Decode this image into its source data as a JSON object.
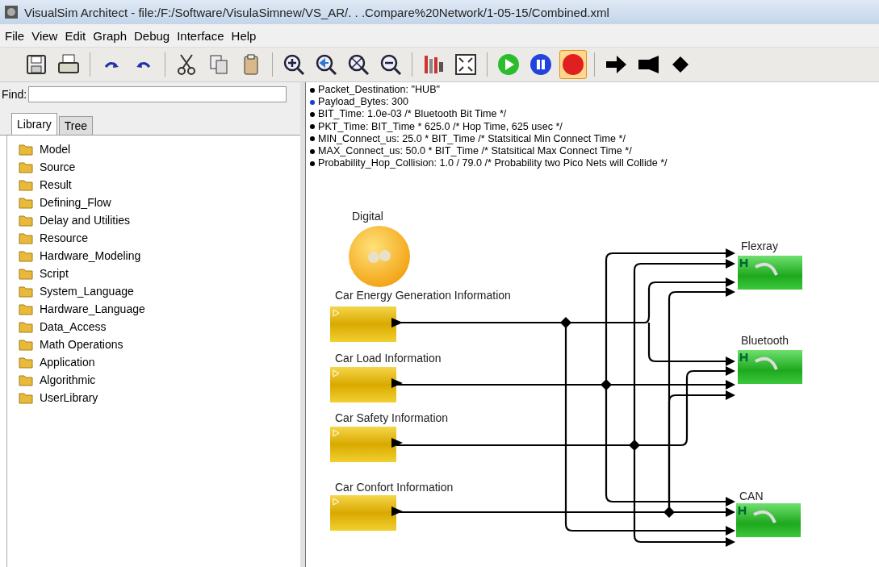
{
  "window": {
    "title": "VisualSim Architect - file:/F:/Software/VisulaSimnew/VS_AR/. . .Compare%20Network/1-05-15/Combined.xml"
  },
  "menu": [
    "File",
    "View",
    "Edit",
    "Graph",
    "Debug",
    "Interface",
    "Help"
  ],
  "toolbar": [
    {
      "kind": "save",
      "selected": false
    },
    {
      "kind": "print",
      "selected": false
    },
    {
      "kind": "sep"
    },
    {
      "kind": "redo",
      "selected": false
    },
    {
      "kind": "undo",
      "selected": false
    },
    {
      "kind": "sep"
    },
    {
      "kind": "cut",
      "selected": false
    },
    {
      "kind": "copy",
      "selected": false
    },
    {
      "kind": "paste",
      "selected": false
    },
    {
      "kind": "sep"
    },
    {
      "kind": "zoom-in",
      "selected": false
    },
    {
      "kind": "zoom-reset",
      "selected": false
    },
    {
      "kind": "zoom-fit",
      "selected": false
    },
    {
      "kind": "zoom-out",
      "selected": false
    },
    {
      "kind": "sep"
    },
    {
      "kind": "chart",
      "selected": false
    },
    {
      "kind": "fullscreen",
      "selected": false
    },
    {
      "kind": "sep"
    },
    {
      "kind": "run",
      "selected": false
    },
    {
      "kind": "pause",
      "selected": false
    },
    {
      "kind": "stop",
      "selected": true
    },
    {
      "kind": "sep"
    },
    {
      "kind": "arrow",
      "selected": false
    },
    {
      "kind": "flag",
      "selected": false
    },
    {
      "kind": "diamond",
      "selected": false
    }
  ],
  "find": {
    "label": "Find:"
  },
  "tabs": [
    {
      "label": "Library",
      "selected": true
    },
    {
      "label": "Tree",
      "selected": false
    }
  ],
  "library_items": [
    "Model",
    "Source",
    "Result",
    "Defining_Flow",
    "Delay and Utilities",
    "Resource",
    "Hardware_Modeling",
    "Script",
    "System_Language",
    "Hardware_Language",
    "Data_Access",
    "Math Operations",
    "Application",
    "Algorithmic",
    "UserLibrary"
  ],
  "parameters": [
    {
      "text": "Packet_Destination: \"HUB\"",
      "color": "#000000"
    },
    {
      "text": "Payload_Bytes: 300",
      "color": "#1a3fd0"
    },
    {
      "text": "BIT_Time: 1.0e-03 /* Bluetooth Bit Time */",
      "color": "#000000"
    },
    {
      "text": "PKT_Time: BIT_Time * 625.0 /* Hop Time, 625 usec */",
      "color": "#000000"
    },
    {
      "text": "MIN_Connect_us: 25.0 * BIT_Time /* Statsitical Min Connect Time */",
      "color": "#000000"
    },
    {
      "text": "MAX_Connect_us: 50.0 * BIT_Time /* Statsitical Max Connect Time */",
      "color": "#000000"
    },
    {
      "text": "Probability_Hop_Collision: 1.0 / 79.0 /* Probability two Pico Nets will Collide */",
      "color": "#000000"
    }
  ],
  "director": {
    "label": "Digital"
  },
  "sources": [
    {
      "label": "Car Energy Generation Information"
    },
    {
      "label": "Car Load Information"
    },
    {
      "label": "Car Safety Information"
    },
    {
      "label": "Car Confort Information"
    }
  ],
  "sinks": [
    {
      "label": "Flexray"
    },
    {
      "label": "Bluetooth"
    },
    {
      "label": "CAN"
    }
  ]
}
